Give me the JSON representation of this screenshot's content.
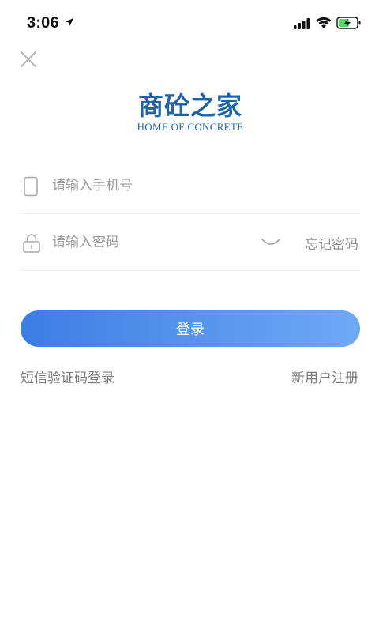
{
  "status_bar": {
    "time": "3:06",
    "icons": [
      "location-arrow-icon",
      "cellular-signal-icon",
      "wifi-icon",
      "battery-charging-icon"
    ],
    "battery_color": "#4cd964"
  },
  "header": {
    "close_icon": "close-icon"
  },
  "logo": {
    "title_cn": "商砼之家",
    "title_en": "HOME  OF CONCRETE",
    "brand_color": "#1f63a8"
  },
  "form": {
    "phone": {
      "placeholder": "请输入手机号",
      "value": "",
      "icon": "phone-icon"
    },
    "password": {
      "placeholder": "请输入密码",
      "value": "",
      "icon": "lock-icon",
      "visibility_icon": "eye-closed-icon",
      "forgot_label": "忘记密码"
    },
    "login_label": "登录",
    "login_gradient": [
      "#3b7ee4",
      "#6fa9f5"
    ]
  },
  "footer_links": {
    "sms_login": "短信验证码登录",
    "register": "新用户注册"
  }
}
